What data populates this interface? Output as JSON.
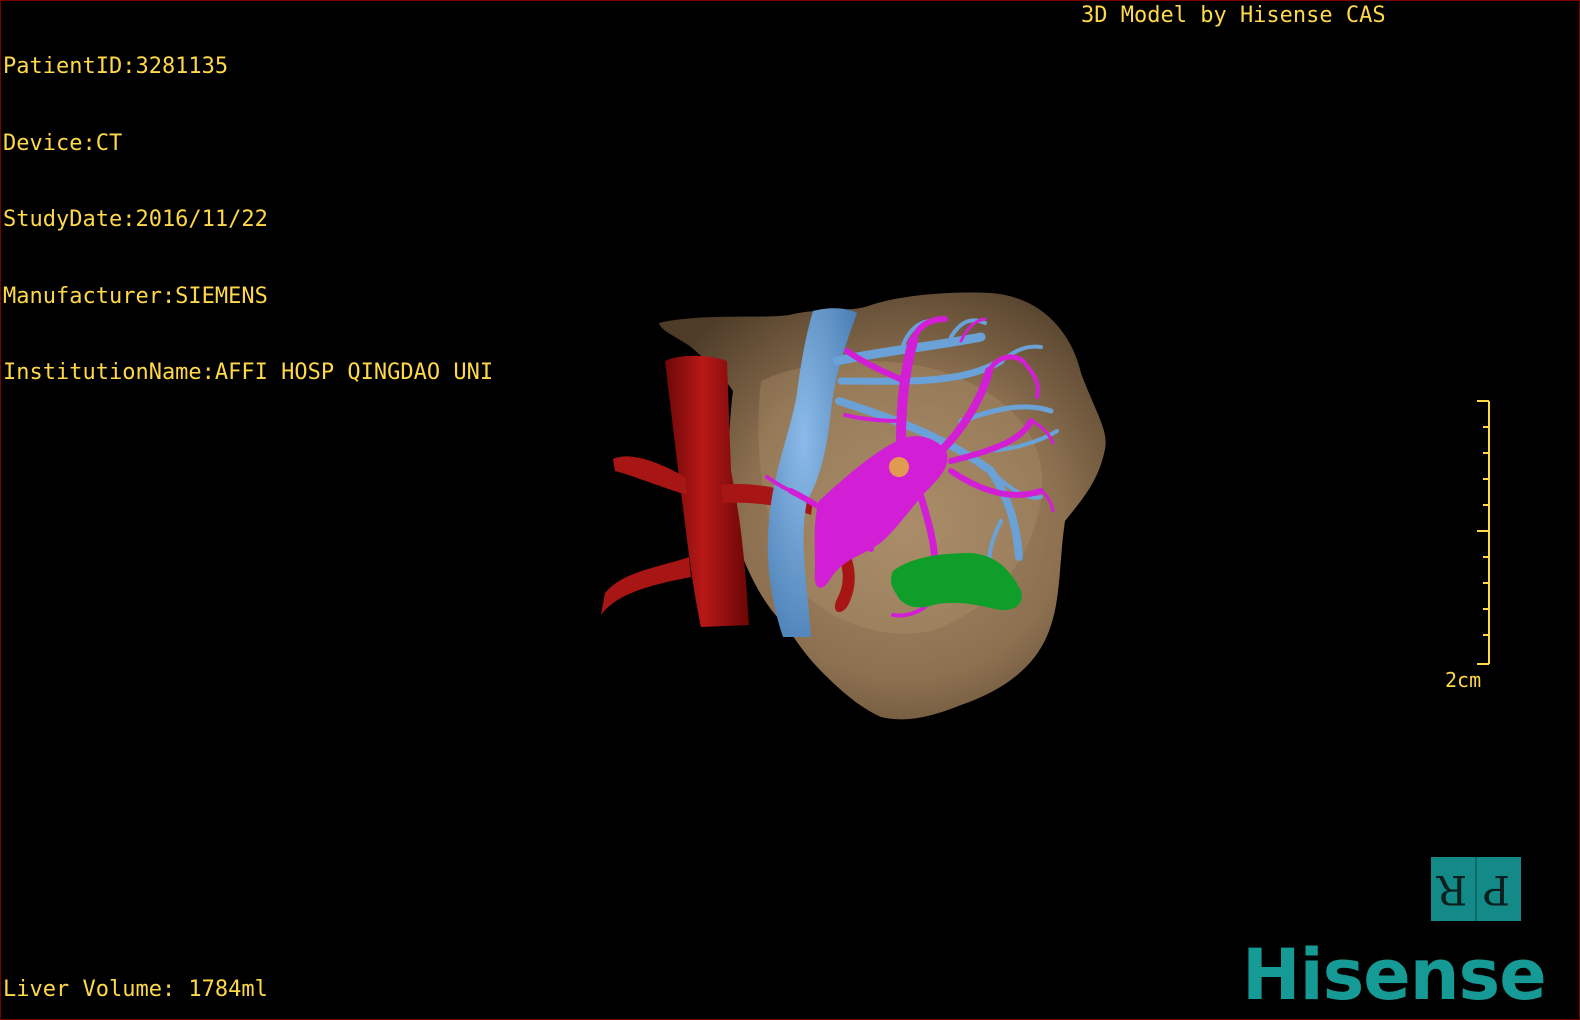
{
  "viewer": {
    "patient_id": "PatientID:3281135",
    "device": "Device:CT",
    "study_date": "StudyDate:2016/11/22",
    "manufacturer": "Manufacturer:SIEMENS",
    "institution": "InstitutionName:AFFI HOSP QINGDAO UNI",
    "credit": "3D Model by Hisense CAS",
    "liver_volume": "Liver Volume: 1784ml",
    "scale_label": "2cm",
    "orientation_left": "R",
    "orientation_right": "P",
    "brand": "Hisense"
  },
  "colors": {
    "overlay_text": "#ffd84a",
    "scale_bar": "#ffd84a",
    "liver": "#9c8160",
    "portal_vein": "#d21fd6",
    "hepatic_vein": "#6aa2d8",
    "artery": "#a81515",
    "tumor": "#0f9e2a",
    "brand": "#159a95",
    "orientation_cube": "#138a87"
  }
}
